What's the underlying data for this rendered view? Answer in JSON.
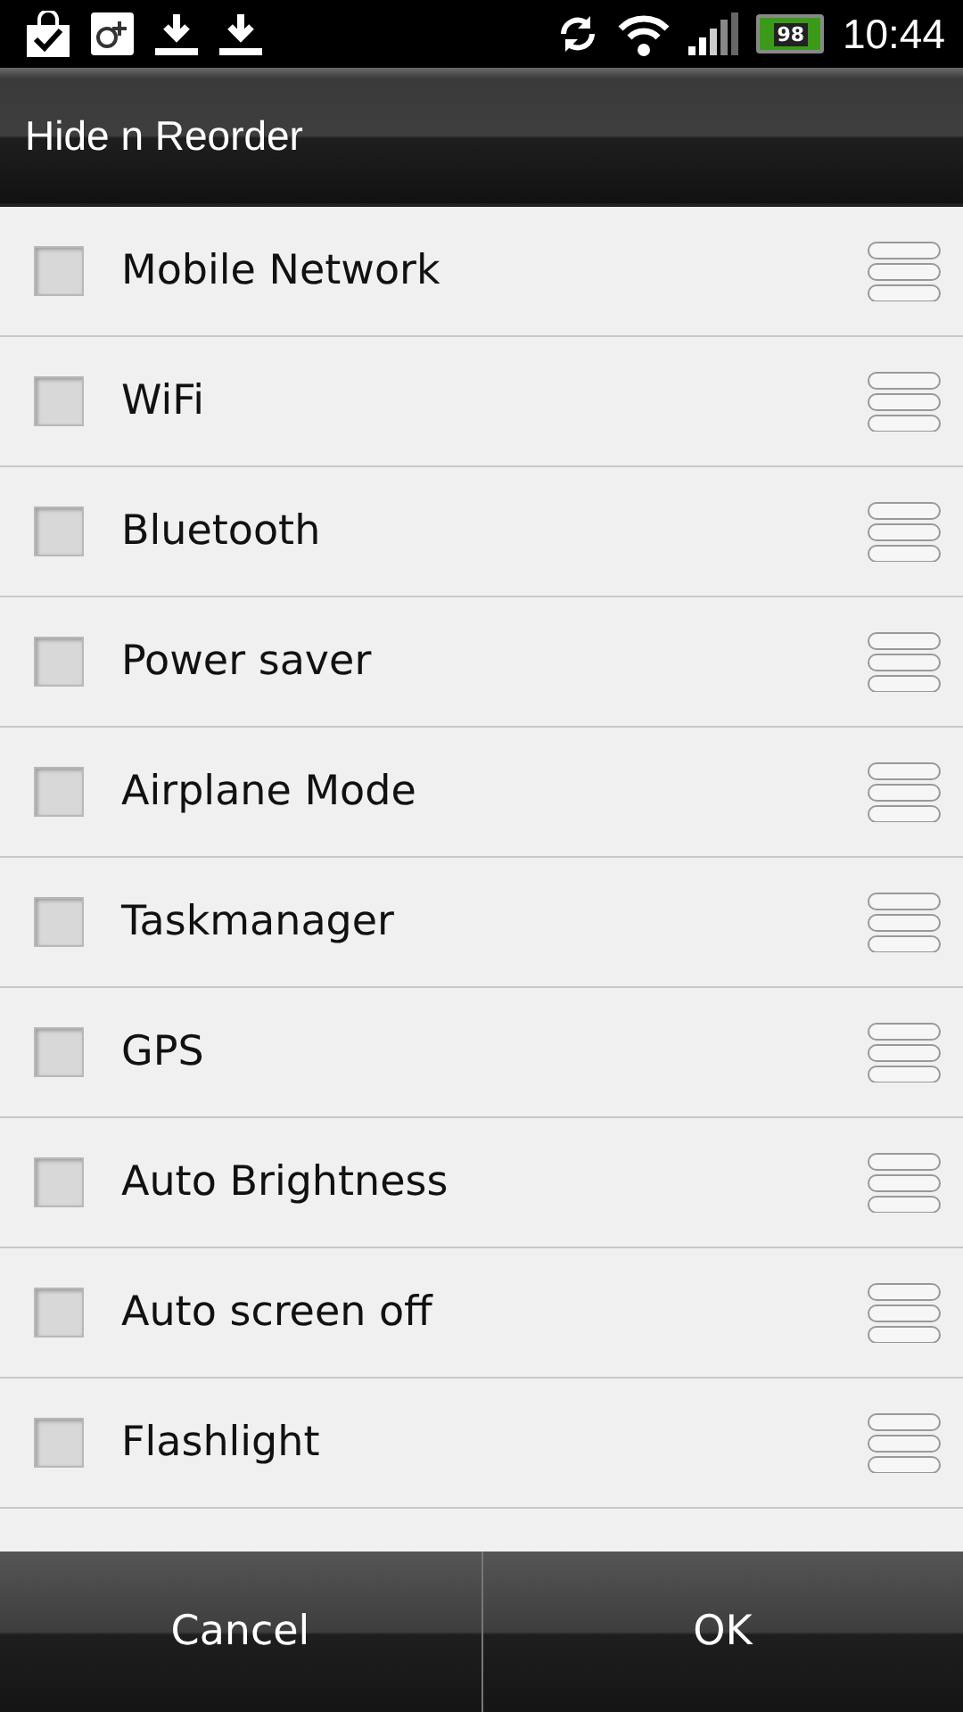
{
  "status_bar": {
    "battery": "98",
    "time": "10:44"
  },
  "title": "Hide n Reorder",
  "items": [
    {
      "label": "Mobile Network",
      "checked": false
    },
    {
      "label": "WiFi",
      "checked": false
    },
    {
      "label": "Bluetooth",
      "checked": false
    },
    {
      "label": "Power saver",
      "checked": false
    },
    {
      "label": "Airplane Mode",
      "checked": false
    },
    {
      "label": "Taskmanager",
      "checked": false
    },
    {
      "label": "GPS",
      "checked": false
    },
    {
      "label": "Auto Brightness",
      "checked": false
    },
    {
      "label": "Auto screen off",
      "checked": false
    },
    {
      "label": "Flashlight",
      "checked": false
    }
  ],
  "buttons": [
    "Cancel",
    "OK"
  ]
}
